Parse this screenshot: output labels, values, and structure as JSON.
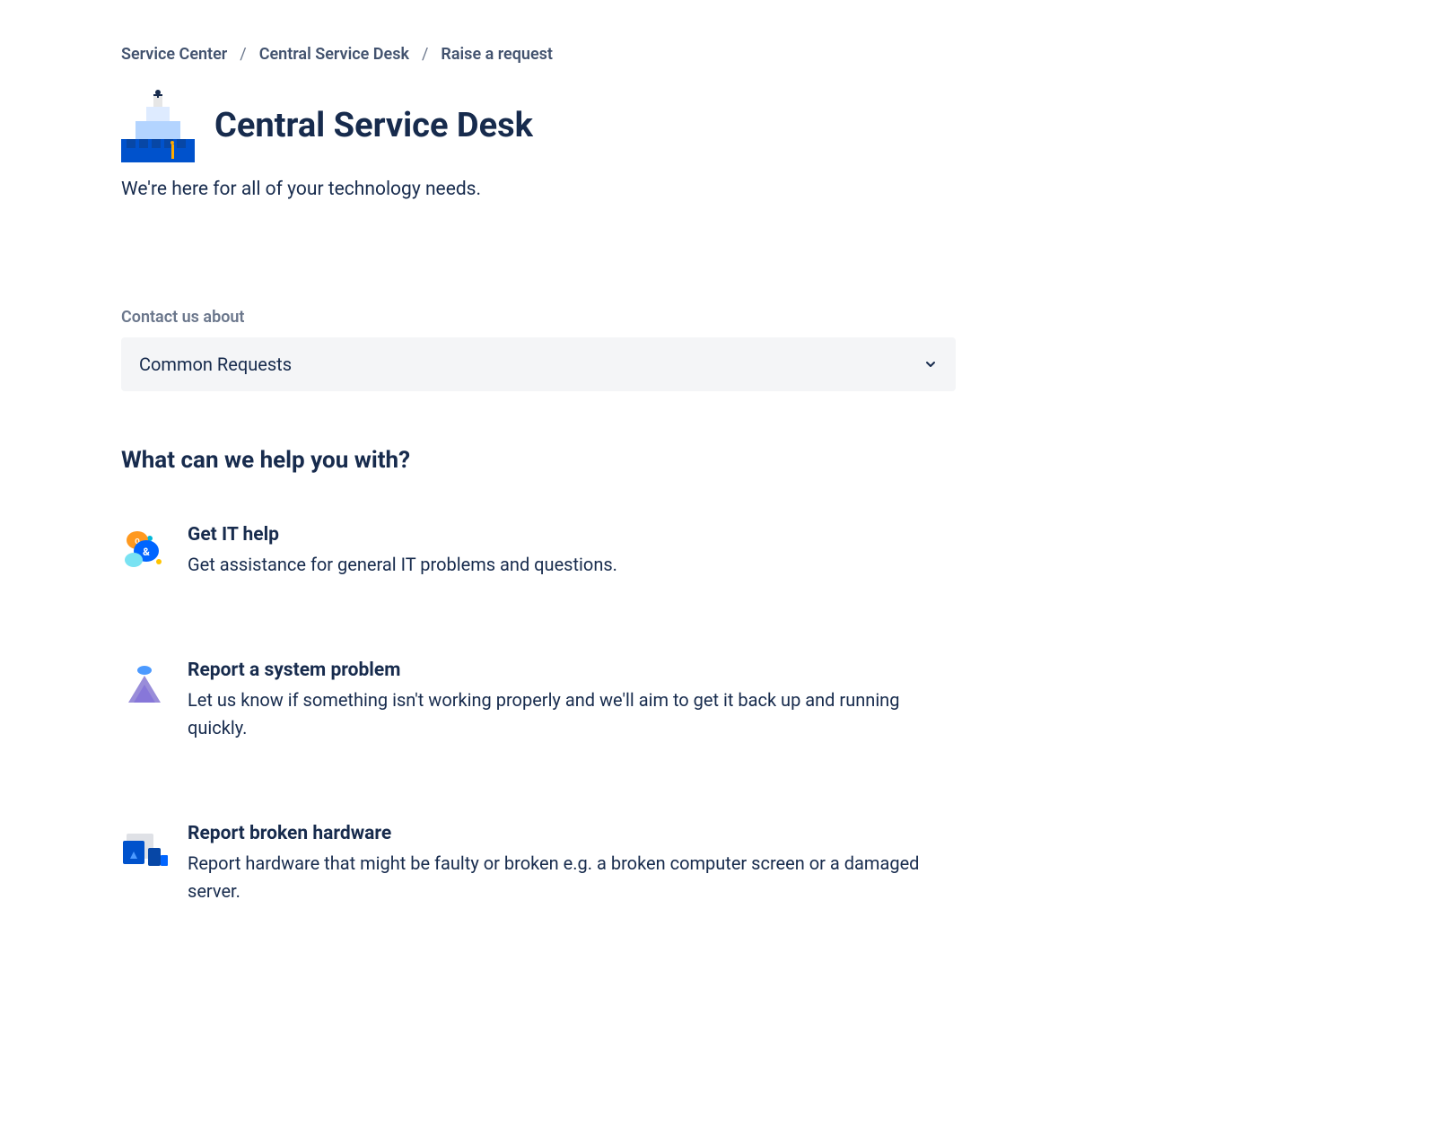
{
  "breadcrumb": {
    "items": [
      {
        "label": "Service Center"
      },
      {
        "label": "Central Service Desk"
      },
      {
        "label": "Raise a request"
      }
    ]
  },
  "header": {
    "title": "Central Service Desk",
    "subtitle": "We're here for all of your technology needs."
  },
  "contact": {
    "label": "Contact us about",
    "selected": "Common Requests"
  },
  "help": {
    "heading": "What can we help you with?",
    "requests": [
      {
        "title": "Get IT help",
        "description": "Get assistance for general IT problems and questions.",
        "icon": "chat-bubbles-icon"
      },
      {
        "title": "Report a system problem",
        "description": "Let us know if something isn't working properly and we'll aim to get it back up and running quickly.",
        "icon": "system-problem-icon"
      },
      {
        "title": "Report broken hardware",
        "description": "Report hardware that might be faulty or broken e.g. a broken computer screen or a damaged server.",
        "icon": "hardware-icon"
      }
    ]
  }
}
